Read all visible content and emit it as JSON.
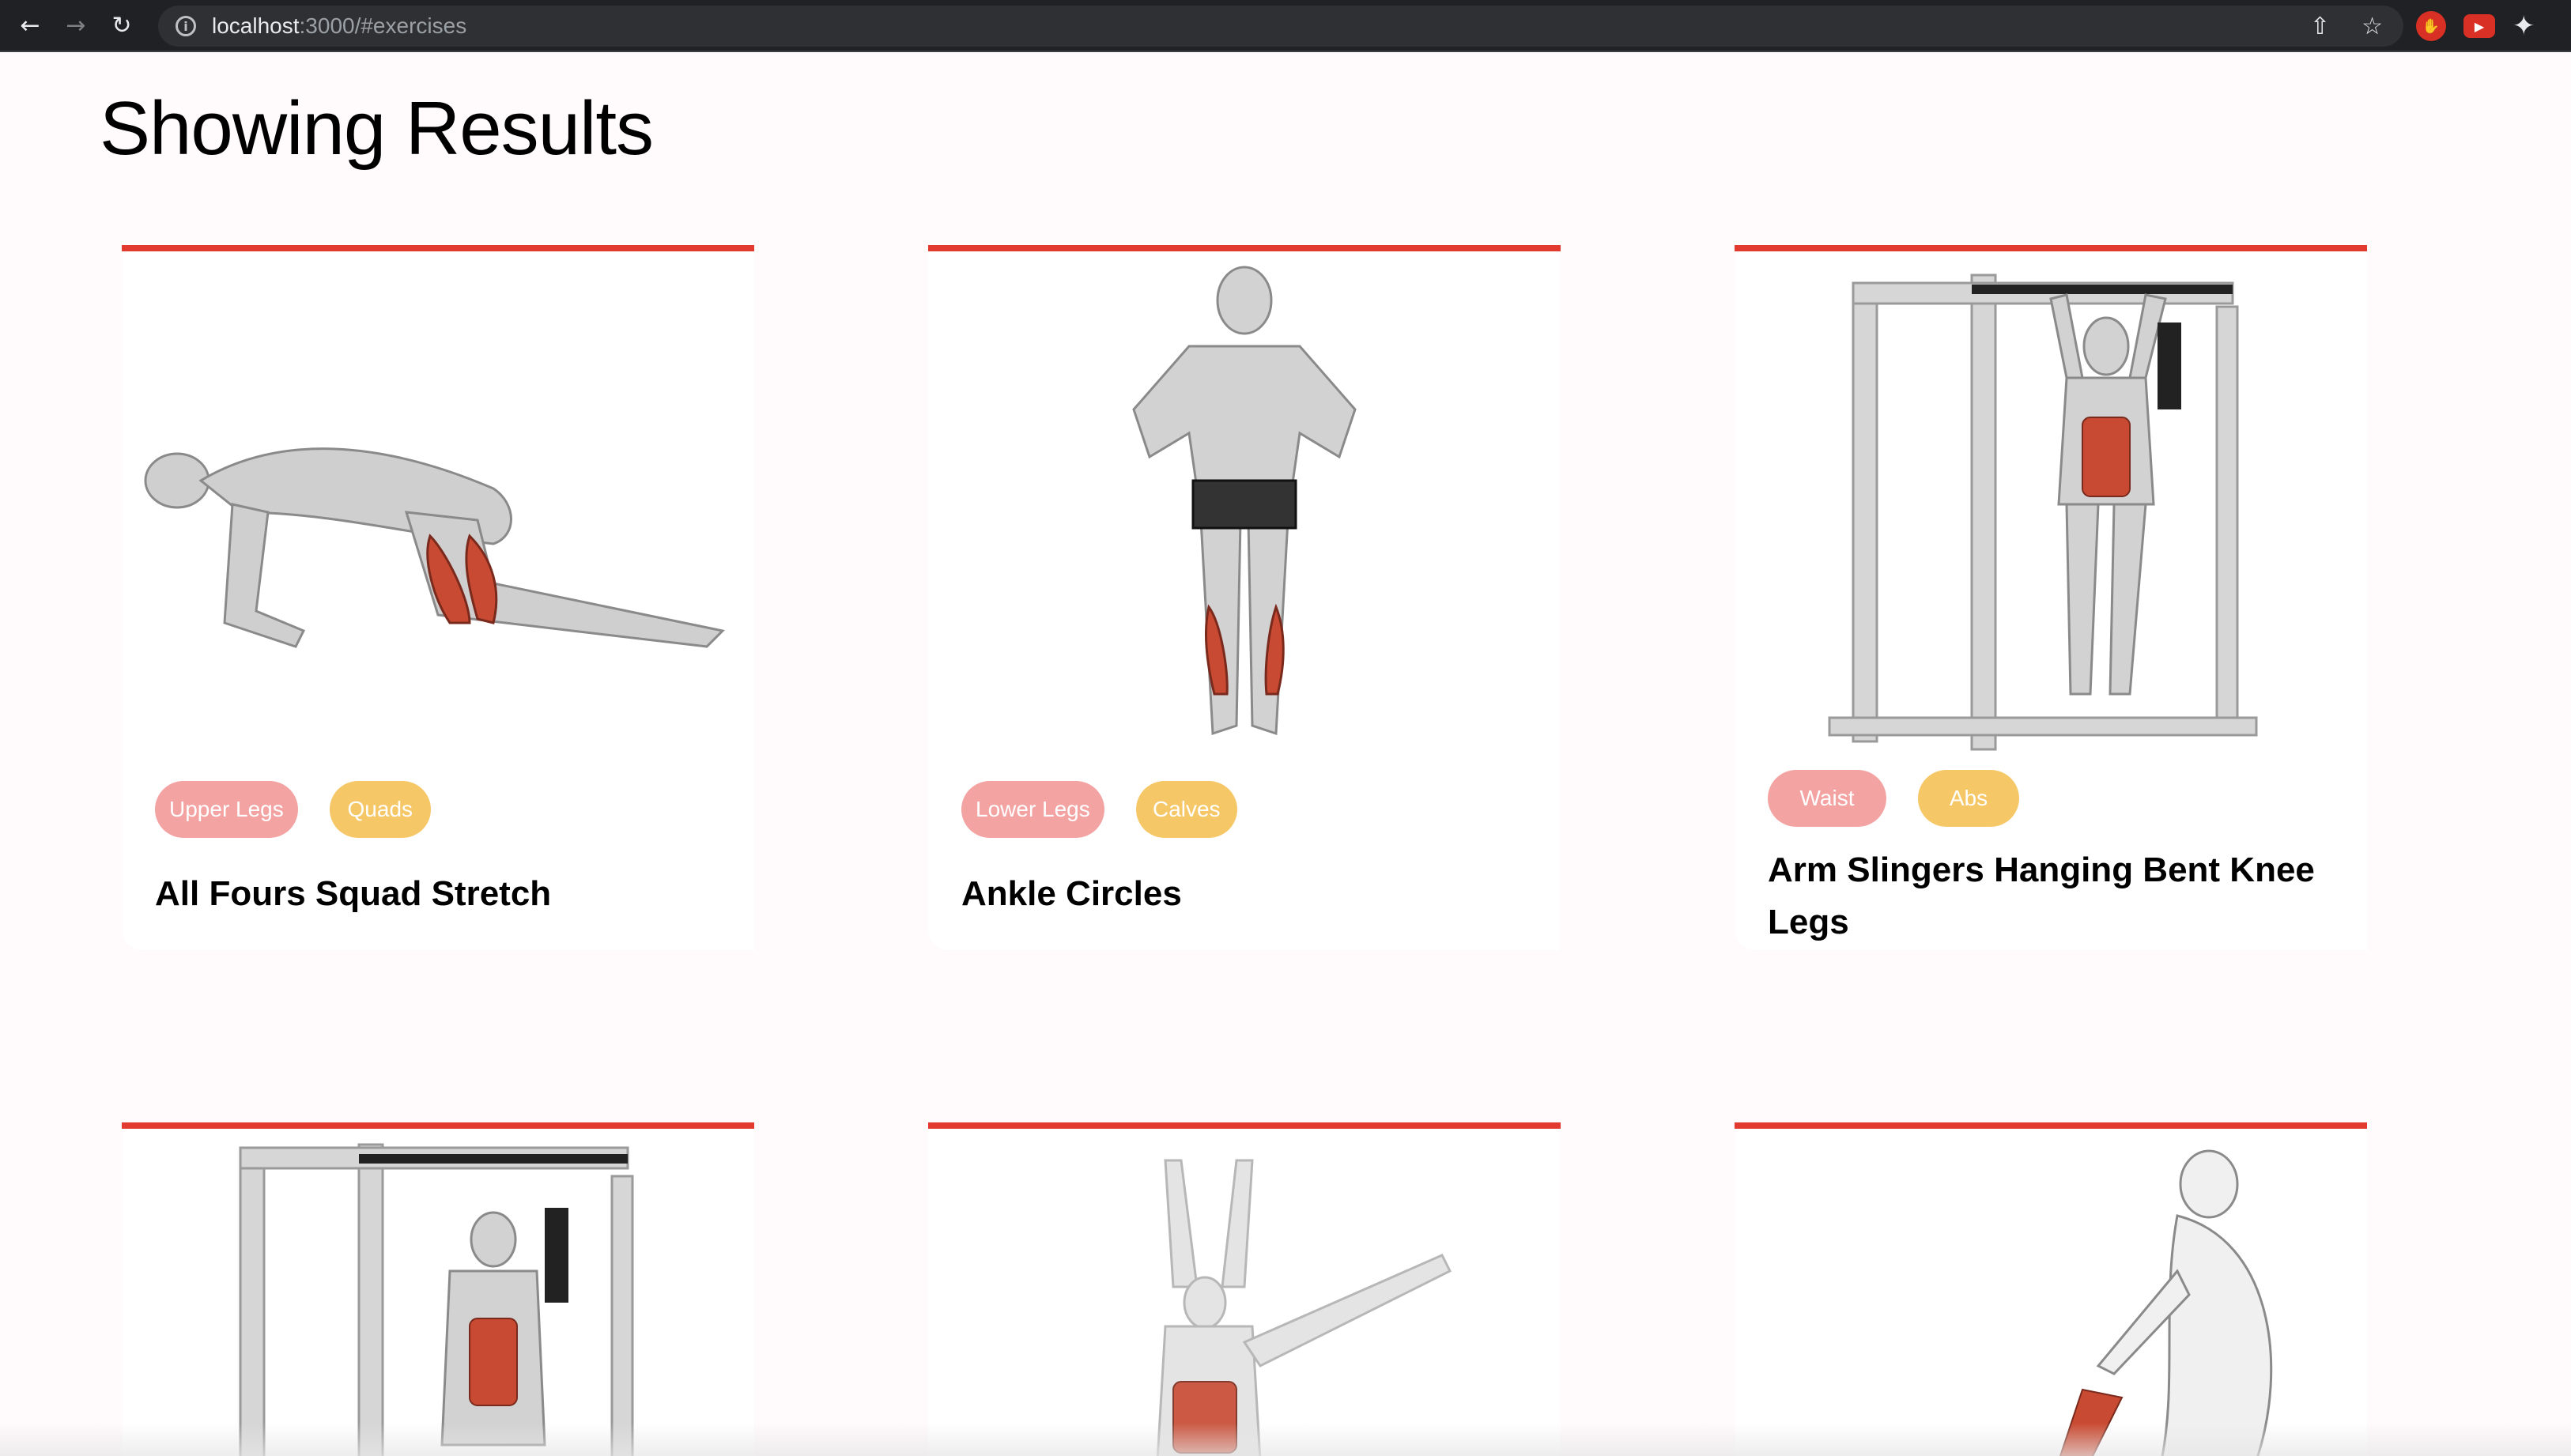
{
  "browser": {
    "url_host": "localhost",
    "url_path": ":3000/#exercises",
    "icons": [
      "back-arrow-icon",
      "forward-arrow-icon",
      "reload-icon",
      "site-info-icon",
      "share-icon",
      "bookmark-star-icon",
      "adblock-extension-icon",
      "youtube-extension-icon",
      "extensions-puzzle-icon"
    ]
  },
  "page": {
    "title": "Showing Results"
  },
  "colors": {
    "accent": "#e33a2f",
    "bodypart_tag": "#f4a3a3",
    "target_tag": "#f6c766",
    "background": "#fffafb"
  },
  "exercises": [
    {
      "name": "All Fours Squad Stretch",
      "body_part": "Upper Legs",
      "target": "Quads"
    },
    {
      "name": "Ankle Circles",
      "body_part": "Lower Legs",
      "target": "Calves"
    },
    {
      "name": "Arm Slingers Hanging Bent Knee Legs",
      "body_part": "Waist",
      "target": "Abs"
    },
    {
      "name": "",
      "body_part": "",
      "target": ""
    },
    {
      "name": "",
      "body_part": "",
      "target": ""
    },
    {
      "name": "",
      "body_part": "",
      "target": ""
    }
  ]
}
